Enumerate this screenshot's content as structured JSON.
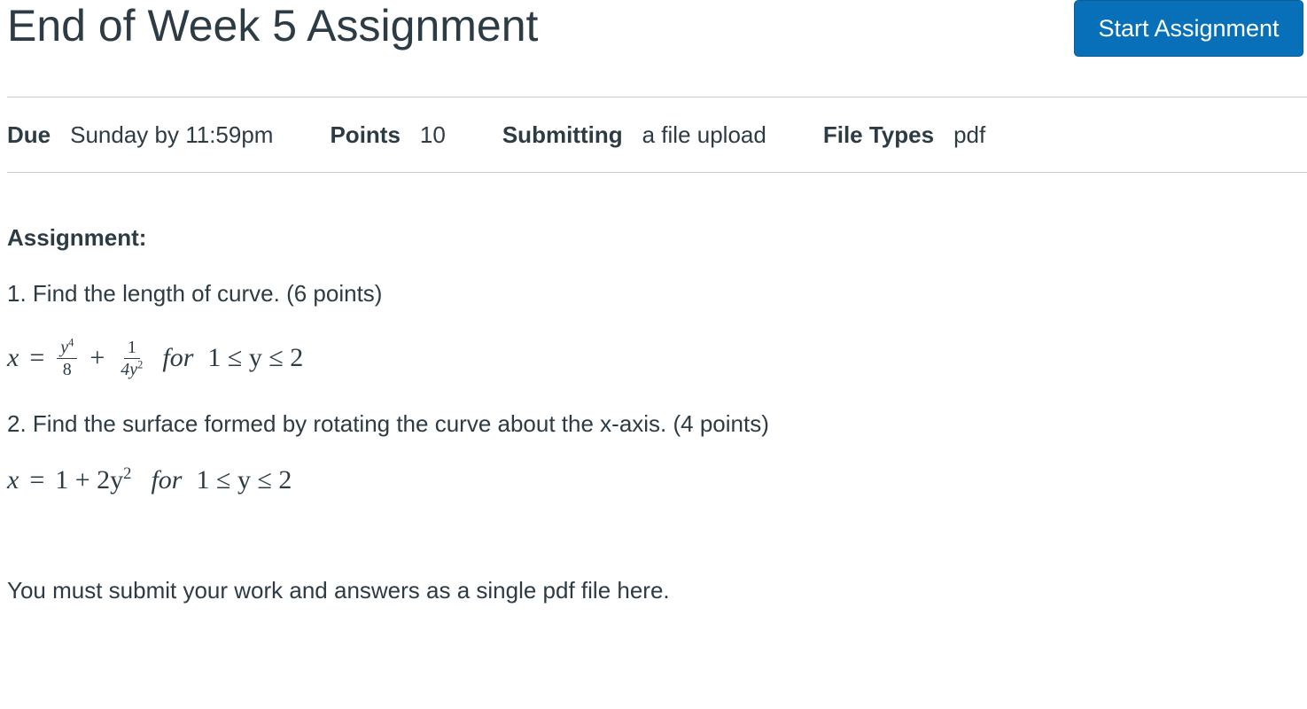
{
  "header": {
    "title": "End of Week 5 Assignment",
    "start_button_label": "Start Assignment"
  },
  "details": {
    "due_label": "Due",
    "due_value": "Sunday by 11:59pm",
    "points_label": "Points",
    "points_value": "10",
    "submitting_label": "Submitting",
    "submitting_value": "a file upload",
    "file_types_label": "File Types",
    "file_types_value": "pdf"
  },
  "content": {
    "heading": "Assignment:",
    "question1": "1.  Find the length of curve. (6 points)",
    "question2": "2.  Find the surface formed by rotating the curve about the x-axis. (4 points)",
    "equation1": {
      "lhs": "x",
      "eq": "=",
      "frac1_num": "y",
      "frac1_num_exp": "4",
      "frac1_den": "8",
      "plus": "+",
      "frac2_num": "1",
      "frac2_den": "4y",
      "frac2_den_exp": "2",
      "for": "for",
      "range": "1 ≤ y ≤ 2"
    },
    "equation2": {
      "lhs": "x",
      "eq": "=",
      "rhs": "1 + 2y",
      "rhs_exp": "2",
      "for": "for",
      "range": "1 ≤ y ≤ 2"
    },
    "submit_note": "You must submit your work and answers as a single pdf file here."
  }
}
